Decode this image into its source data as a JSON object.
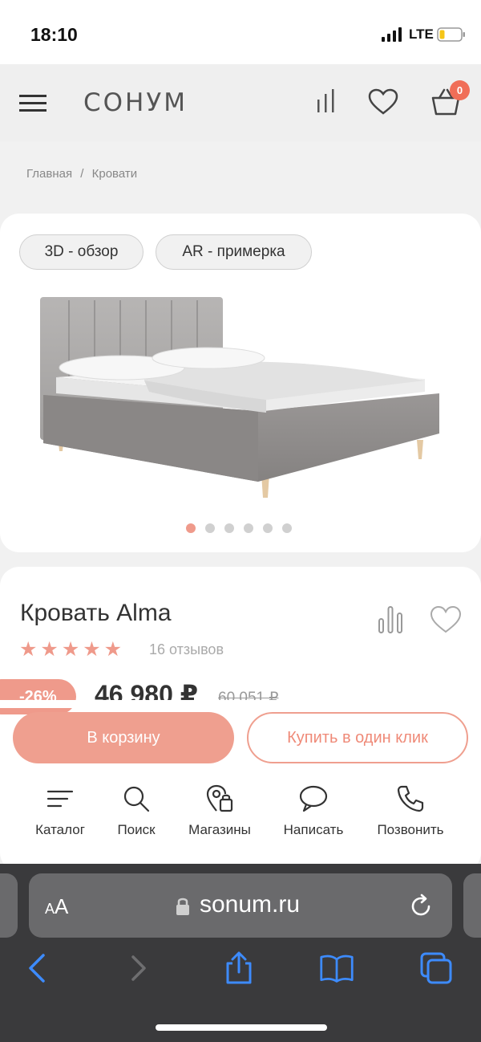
{
  "status_bar": {
    "time": "18:10",
    "network": "LTE"
  },
  "header": {
    "logo": "СОНУМ",
    "cart_count": "0"
  },
  "breadcrumb": {
    "items": [
      "Главная",
      "/",
      "Кровати"
    ]
  },
  "gallery": {
    "btn_3d": "3D - обзор",
    "btn_ar": "AR - примерка",
    "slides": 6,
    "active_slide": 1
  },
  "product": {
    "title": "Кровать Alma",
    "rating": 5,
    "stars": "★★★★★",
    "reviews": "16 отзывов",
    "discount": "-26%",
    "price": "46 980 ₽",
    "old_price": "60 051 ₽"
  },
  "actions": {
    "add_to_cart": "В корзину",
    "one_click": "Купить в один клик"
  },
  "bottom_nav": {
    "items": [
      {
        "label": "Каталог",
        "icon": "catalog-icon"
      },
      {
        "label": "Поиск",
        "icon": "search-icon"
      },
      {
        "label": "Магазины",
        "icon": "store-location-icon"
      },
      {
        "label": "Написать",
        "icon": "chat-icon"
      },
      {
        "label": "Позвонить",
        "icon": "phone-icon"
      }
    ]
  },
  "browser": {
    "aa_small": "A",
    "aa_large": "A",
    "url": "sonum.ru"
  },
  "colors": {
    "accent": "#ef9f8f",
    "badge": "#f06e58",
    "safari_bar": "#3a3a3c",
    "ios_blue": "#3d8bfd"
  }
}
